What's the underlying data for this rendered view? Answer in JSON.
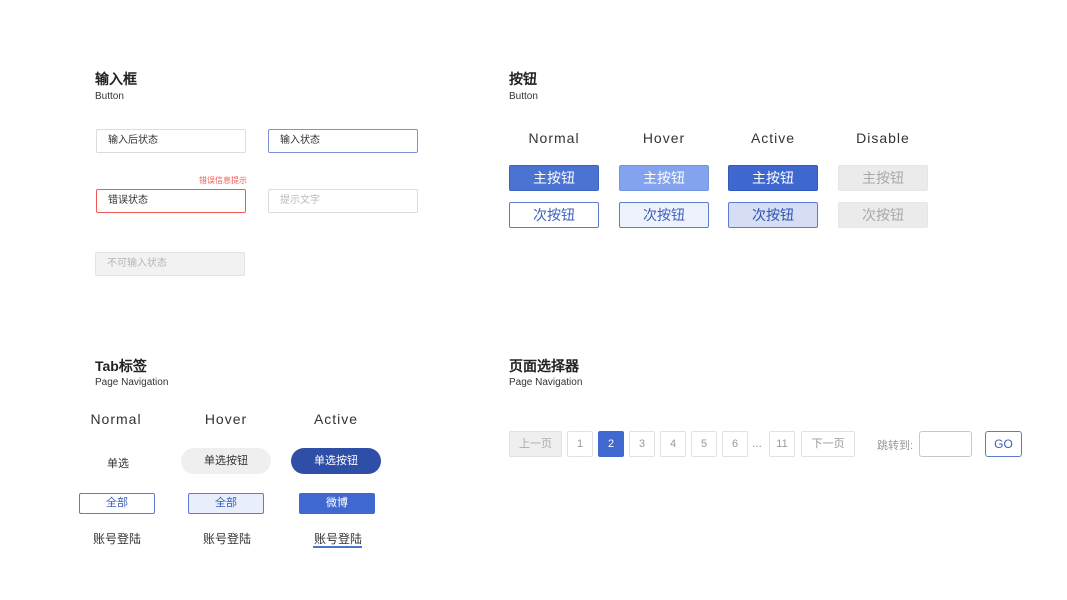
{
  "input_section": {
    "title": "输入框",
    "subtitle": "Button",
    "input_after": "输入后状态",
    "input_focus": "输入状态",
    "error_tip": "错误信息提示",
    "input_error": "错误状态",
    "placeholder_text": "提示文字",
    "input_disabled": "不可输入状态"
  },
  "button_section": {
    "title": "按钮",
    "subtitle": "Button",
    "columns": [
      "Normal",
      "Hover",
      "Active",
      "Disable"
    ],
    "primary_label": "主按钮",
    "secondary_label": "次按钮"
  },
  "tab_section": {
    "title": "Tab标签",
    "subtitle": "Page Navigation",
    "columns": [
      "Normal",
      "Hover",
      "Active"
    ],
    "radio_normal": "单选",
    "radio_hover": "单选按钮",
    "radio_active": "单选按钮",
    "tag_normal": "全部",
    "tag_hover": "全部",
    "tag_active": "微博",
    "link_normal": "账号登陆",
    "link_hover": "账号登陆",
    "link_active": "账号登陆"
  },
  "pager_section": {
    "title": "页面选择器",
    "subtitle": "Page Navigation",
    "prev": "上一页",
    "pages": [
      "1",
      "2",
      "3",
      "4",
      "5",
      "6"
    ],
    "current_page": "2",
    "ellipsis": "...",
    "last_page": "11",
    "next": "下一页",
    "jump_label": "跳转到:",
    "jump_value": "",
    "go": "GO"
  },
  "colors": {
    "accent": "#4a73d2",
    "accent_dark": "#2f4ea8",
    "error": "#f05a55",
    "disabled_bg": "#ebebeb"
  }
}
